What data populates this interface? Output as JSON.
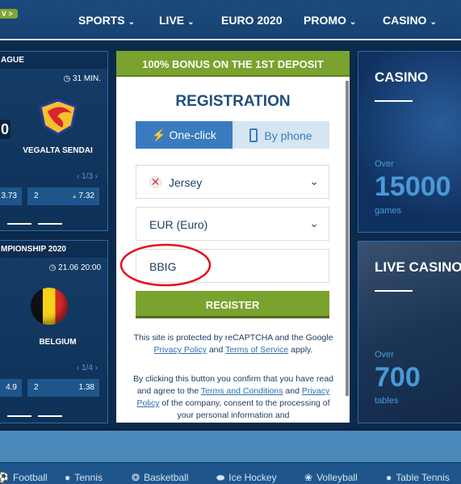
{
  "header": {
    "badge": "V >",
    "nav": [
      {
        "label": "SPORTS",
        "chevron": true
      },
      {
        "label": "LIVE",
        "chevron": true
      },
      {
        "label": "EURO 2020",
        "chevron": false
      },
      {
        "label": "PROMO",
        "chevron": true
      },
      {
        "label": "CASINO",
        "chevron": true
      }
    ]
  },
  "matches": [
    {
      "league": "AGUE",
      "time": "31 MIN.",
      "score": "0",
      "team": "VEGALTA SENDAI",
      "page": "1/3",
      "odds": [
        {
          "label": "",
          "value": "3.73"
        },
        {
          "label": "2",
          "value": "7.32",
          "trend": "up"
        }
      ]
    },
    {
      "league": "MPIONSHIP 2020",
      "time": "21.06 20:00",
      "team": "BELGIUM",
      "page": "1/4",
      "odds": [
        {
          "label": "",
          "value": "4.9"
        },
        {
          "label": "2",
          "value": "1.38"
        }
      ]
    }
  ],
  "registration": {
    "bonus": "100% BONUS ON THE 1ST DEPOSIT",
    "title": "REGISTRATION",
    "tabs": [
      {
        "label": "One-click",
        "active": true
      },
      {
        "label": "By phone",
        "active": false
      }
    ],
    "country": "Jersey",
    "currency": "EUR (Euro)",
    "promo_code": "BBIG",
    "register": "REGISTER",
    "recaptcha": {
      "t1": "This site is protected by reCAPTCHA and the Google ",
      "privacy": "Privacy Policy",
      "and": " and ",
      "terms": "Terms of Service",
      "apply": " apply."
    },
    "consent": {
      "t1": "By clicking this button you confirm that you have read and agree to the ",
      "terms": "Terms and Conditions",
      "and": " and ",
      "privacy": "Privacy Policy",
      "t2": " of the company, consent to the processing of your personal information and"
    }
  },
  "promos": [
    {
      "title": "CASINO",
      "over": "Over",
      "count": "15000",
      "unit": "games"
    },
    {
      "title": "LIVE CASINO",
      "over": "Over",
      "count": "700",
      "unit": "tables"
    }
  ],
  "sports": [
    "Football",
    "Tennis",
    "Basketball",
    "Ice Hockey",
    "Volleyball",
    "Table Tennis"
  ],
  "colors": {
    "accent_green": "#7aa22e",
    "primary_blue": "#3a7bbf",
    "background": "#0c2a4b",
    "highlight_circle": "#e0141e"
  }
}
